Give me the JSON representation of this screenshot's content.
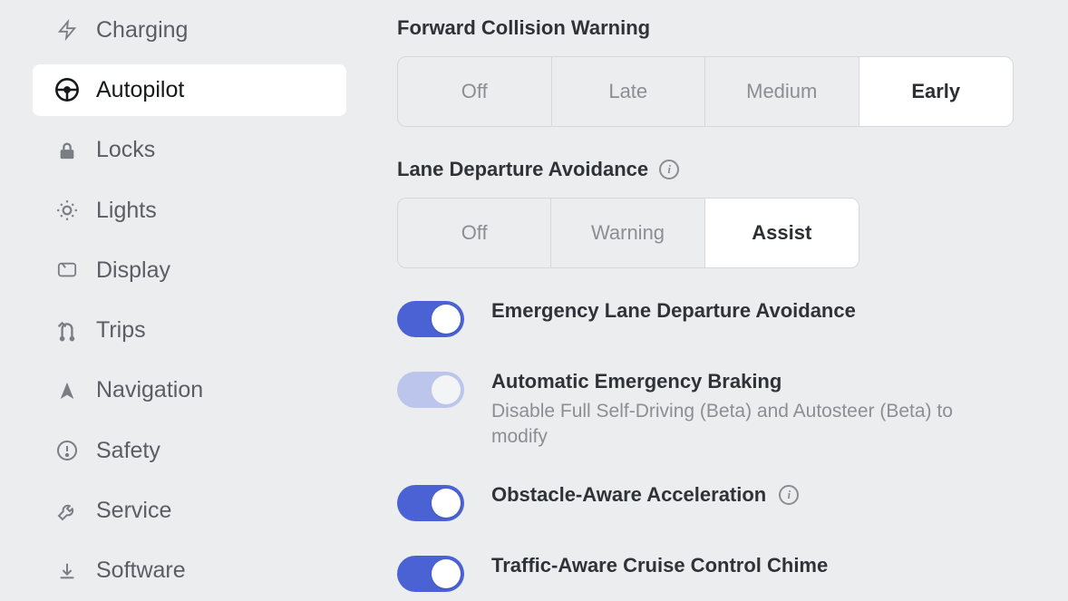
{
  "sidebar": {
    "items": [
      {
        "id": "charging",
        "label": "Charging",
        "icon": "bolt-icon",
        "active": false
      },
      {
        "id": "autopilot",
        "label": "Autopilot",
        "icon": "steering-icon",
        "active": true
      },
      {
        "id": "locks",
        "label": "Locks",
        "icon": "lock-icon",
        "active": false
      },
      {
        "id": "lights",
        "label": "Lights",
        "icon": "bulb-icon",
        "active": false
      },
      {
        "id": "display",
        "label": "Display",
        "icon": "display-icon",
        "active": false
      },
      {
        "id": "trips",
        "label": "Trips",
        "icon": "route-icon",
        "active": false
      },
      {
        "id": "navigation",
        "label": "Navigation",
        "icon": "nav-arrow-icon",
        "active": false
      },
      {
        "id": "safety",
        "label": "Safety",
        "icon": "alert-circle-icon",
        "active": false
      },
      {
        "id": "service",
        "label": "Service",
        "icon": "wrench-icon",
        "active": false
      },
      {
        "id": "software",
        "label": "Software",
        "icon": "download-icon",
        "active": false
      }
    ]
  },
  "sections": {
    "fcw": {
      "title": "Forward Collision Warning",
      "options": [
        "Off",
        "Late",
        "Medium",
        "Early"
      ],
      "selected": "Early"
    },
    "lda": {
      "title": "Lane Departure Avoidance",
      "has_info": true,
      "options": [
        "Off",
        "Warning",
        "Assist"
      ],
      "selected": "Assist"
    }
  },
  "toggles": {
    "elda": {
      "title": "Emergency Lane Departure Avoidance",
      "on": true,
      "disabled": false,
      "has_info": false
    },
    "aeb": {
      "title": "Automatic Emergency Braking",
      "subtitle": "Disable Full Self-Driving (Beta) and Autosteer (Beta) to modify",
      "on": true,
      "disabled": true,
      "has_info": false
    },
    "oaa": {
      "title": "Obstacle-Aware Acceleration",
      "on": true,
      "disabled": false,
      "has_info": true
    },
    "tacc": {
      "title": "Traffic-Aware Cruise Control Chime",
      "on": true,
      "disabled": false,
      "has_info": false
    }
  }
}
